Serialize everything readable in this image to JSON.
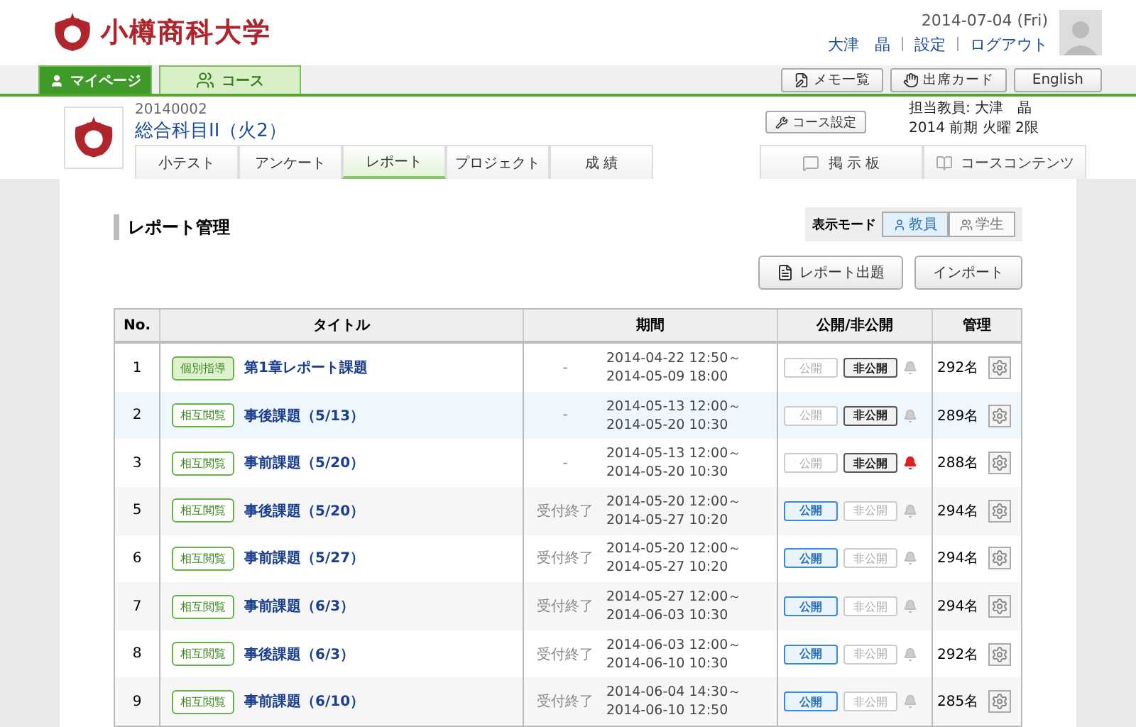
{
  "header": {
    "university": "小樽商科大学",
    "date": "2014-07-04 (Fri)",
    "user_links": [
      {
        "label": "大津　晶"
      },
      {
        "label": "設定"
      },
      {
        "label": "ログアウト"
      }
    ]
  },
  "nav": {
    "tabs": [
      {
        "label": "マイページ",
        "selected": true,
        "kind": "user"
      },
      {
        "label": "コース",
        "selected": false,
        "kind": "course"
      }
    ],
    "tools": [
      {
        "label": "メモ一覧",
        "kind": "memo"
      },
      {
        "label": "出席カード",
        "kind": "attendance"
      },
      {
        "label": "English",
        "kind": "plain"
      }
    ]
  },
  "course": {
    "code": "20140002",
    "title": "総合科目II（火2）",
    "settings_button": "コース設定",
    "teacher": "担当教員: 大津　晶",
    "term": "2014 前期 火曜 2限",
    "tabs": [
      {
        "label": "小テスト",
        "selected": false
      },
      {
        "label": "アンケート",
        "selected": false
      },
      {
        "label": "レポート",
        "selected": true
      },
      {
        "label": "プロジェクト",
        "selected": false
      },
      {
        "label": "成 績",
        "selected": false
      }
    ],
    "side_tabs": [
      {
        "label": "掲 示 板",
        "kind": "board"
      },
      {
        "label": "コースコンテンツ",
        "kind": "contents"
      }
    ]
  },
  "section": {
    "title": "レポート管理",
    "mode_label": "表示モード",
    "modes": [
      {
        "label": "教員",
        "selected": true
      },
      {
        "label": "学生",
        "selected": false
      }
    ],
    "actions": [
      {
        "label": "レポート出題",
        "kind": "new"
      },
      {
        "label": "インポート",
        "kind": "plain"
      }
    ]
  },
  "table": {
    "columns": [
      "No.",
      "タイトル",
      "期間",
      "公開/非公開",
      "管理"
    ],
    "rows": [
      {
        "no": "1",
        "tag": "個別指導",
        "kind": "individual",
        "title": "第1章レポート課題",
        "status": "-",
        "period": [
          "2014-04-22 12:50～",
          "2014-05-09 18:00"
        ],
        "publish": [
          {
            "label": "公開",
            "selected": false
          },
          {
            "label": "非公開",
            "selected": true
          }
        ],
        "alert": false,
        "count": "292名",
        "highlighted": false
      },
      {
        "no": "2",
        "tag": "相互閲覧",
        "kind": "mutual",
        "title": "事後課題（5/13）",
        "status": "-",
        "period": [
          "2014-05-13 12:00～",
          "2014-05-20 10:30"
        ],
        "publish": [
          {
            "label": "公開",
            "selected": false
          },
          {
            "label": "非公開",
            "selected": true
          }
        ],
        "alert": false,
        "count": "289名",
        "highlighted": true
      },
      {
        "no": "3",
        "tag": "相互閲覧",
        "kind": "mutual",
        "title": "事前課題（5/20）",
        "status": "-",
        "period": [
          "2014-05-13 12:00～",
          "2014-05-20 10:30"
        ],
        "publish": [
          {
            "label": "公開",
            "selected": false
          },
          {
            "label": "非公開",
            "selected": true
          }
        ],
        "alert": true,
        "count": "288名",
        "highlighted": false
      },
      {
        "no": "5",
        "tag": "相互閲覧",
        "kind": "mutual",
        "title": "事後課題（5/20）",
        "status": "受付終了",
        "period": [
          "2014-05-20 12:00～",
          "2014-05-27 10:20"
        ],
        "publish": [
          {
            "label": "公開",
            "selected": true
          },
          {
            "label": "非公開",
            "selected": false
          }
        ],
        "alert": false,
        "count": "294名",
        "highlighted": false
      },
      {
        "no": "6",
        "tag": "相互閲覧",
        "kind": "mutual",
        "title": "事前課題（5/27）",
        "status": "受付終了",
        "period": [
          "2014-05-20 12:00～",
          "2014-05-27 10:20"
        ],
        "publish": [
          {
            "label": "公開",
            "selected": true
          },
          {
            "label": "非公開",
            "selected": false
          }
        ],
        "alert": false,
        "count": "294名",
        "highlighted": false
      },
      {
        "no": "7",
        "tag": "相互閲覧",
        "kind": "mutual",
        "title": "事前課題（6/3）",
        "status": "受付終了",
        "period": [
          "2014-05-27 12:00～",
          "2014-06-03 10:30"
        ],
        "publish": [
          {
            "label": "公開",
            "selected": true
          },
          {
            "label": "非公開",
            "selected": false
          }
        ],
        "alert": false,
        "count": "294名",
        "highlighted": false
      },
      {
        "no": "8",
        "tag": "相互閲覧",
        "kind": "mutual",
        "title": "事後課題（6/3）",
        "status": "受付終了",
        "period": [
          "2014-06-03 12:00～",
          "2014-06-10 10:30"
        ],
        "publish": [
          {
            "label": "公開",
            "selected": true
          },
          {
            "label": "非公開",
            "selected": false
          }
        ],
        "alert": false,
        "count": "292名",
        "highlighted": false
      },
      {
        "no": "9",
        "tag": "相互閲覧",
        "kind": "mutual",
        "title": "事前課題（6/10）",
        "status": "受付終了",
        "period": [
          "2014-06-04 14:30～",
          "2014-06-10 12:50"
        ],
        "publish": [
          {
            "label": "公開",
            "selected": true
          },
          {
            "label": "非公開",
            "selected": false
          }
        ],
        "alert": false,
        "count": "285名",
        "highlighted": false
      }
    ]
  }
}
